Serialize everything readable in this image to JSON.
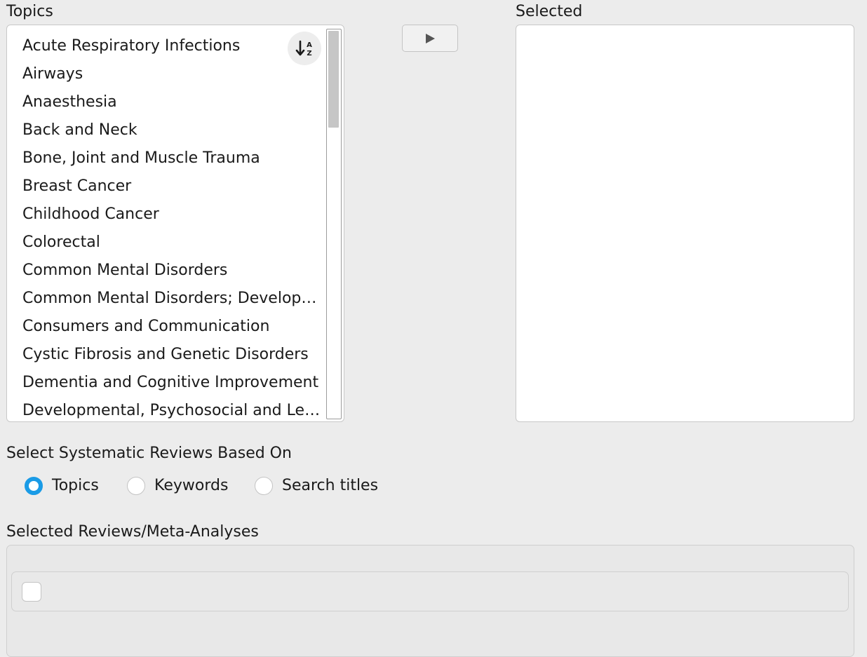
{
  "topics": {
    "label": "Topics",
    "sort_icon": "sort-alpha-down-icon",
    "items": [
      "Acute Respiratory Infections",
      "Airways",
      "Anaesthesia",
      "Back and Neck",
      "Bone, Joint and Muscle Trauma",
      "Breast Cancer",
      "Childhood Cancer",
      "Colorectal",
      "Common Mental Disorders",
      "Common Mental Disorders; Developmental, Psychosocial and Learning Problems",
      "Consumers and Communication",
      "Cystic Fibrosis and Genetic Disorders",
      "Dementia and Cognitive Improvement",
      "Developmental, Psychosocial and Learning Problems"
    ]
  },
  "transfer": {
    "icon": "play-right-icon"
  },
  "selected": {
    "label": "Selected",
    "items": []
  },
  "select_based_on": {
    "label": "Select Systematic Reviews Based On",
    "options": [
      {
        "label": "Topics",
        "checked": true
      },
      {
        "label": "Keywords",
        "checked": false
      },
      {
        "label": "Search titles",
        "checked": false
      }
    ]
  },
  "reviews": {
    "label": "Selected Reviews/Meta-Analyses",
    "rows": [
      {
        "checked": false,
        "text": ""
      }
    ]
  },
  "colors": {
    "background": "#ececec",
    "accent": "#1a9be6",
    "border": "#c8c8c8"
  }
}
